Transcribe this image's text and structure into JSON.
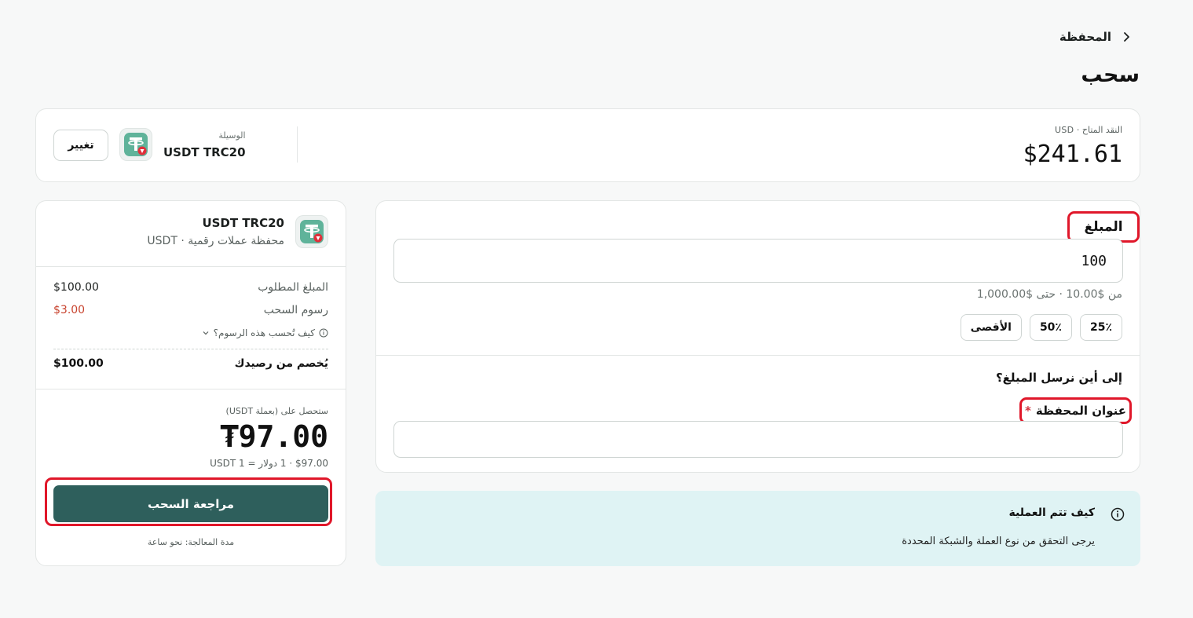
{
  "breadcrumb": {
    "label": "المحفظة"
  },
  "page": {
    "title": "سحب"
  },
  "balance": {
    "label": "النقد المتاح · USD",
    "value": "$241.61"
  },
  "method": {
    "caption": "الوسيلة",
    "name": "USDT TRC20",
    "change_label": "تغيير"
  },
  "form": {
    "amount_label": "المبلغ",
    "amount_value": "100",
    "range_hint": "من $10.00 · حتى $1,000.00",
    "pct_buttons": [
      "25٪",
      "50٪",
      "الأقصى"
    ],
    "destination_title": "إلى أين نرسل المبلغ؟",
    "wallet_label": "عنوان المحفظة",
    "required_mark": "*",
    "wallet_value": ""
  },
  "info": {
    "title": "كيف تتم العملية",
    "body": "يرجى التحقق من نوع العملة والشبكة المحددة"
  },
  "summary": {
    "asset": "USDT TRC20",
    "subtitle": "محفظة عملات رقمية · USDT",
    "requested_label": "المبلغ المطلوب",
    "requested_value": "$100.00",
    "fee_label": "رسوم السحب",
    "fee_value": "$3.00",
    "fee_help": "كيف تُحسب هذه الرسوم؟",
    "deducted_label": "يُخصم من رصيدك",
    "deducted_value": "$100.00",
    "receive_label": "ستحصل على (بعملة USDT)",
    "receive_value": "₮97.00",
    "rate_line": "$97.00 · 1 دولار = 1 USDT",
    "review_button": "مراجعة السحب",
    "processing": "مدة المعالجة: نحو ساعة"
  },
  "colors": {
    "primary": "#2e5f5c",
    "fee": "#c8432e",
    "highlight": "#e0172a",
    "info_bg": "#dff3f4"
  }
}
